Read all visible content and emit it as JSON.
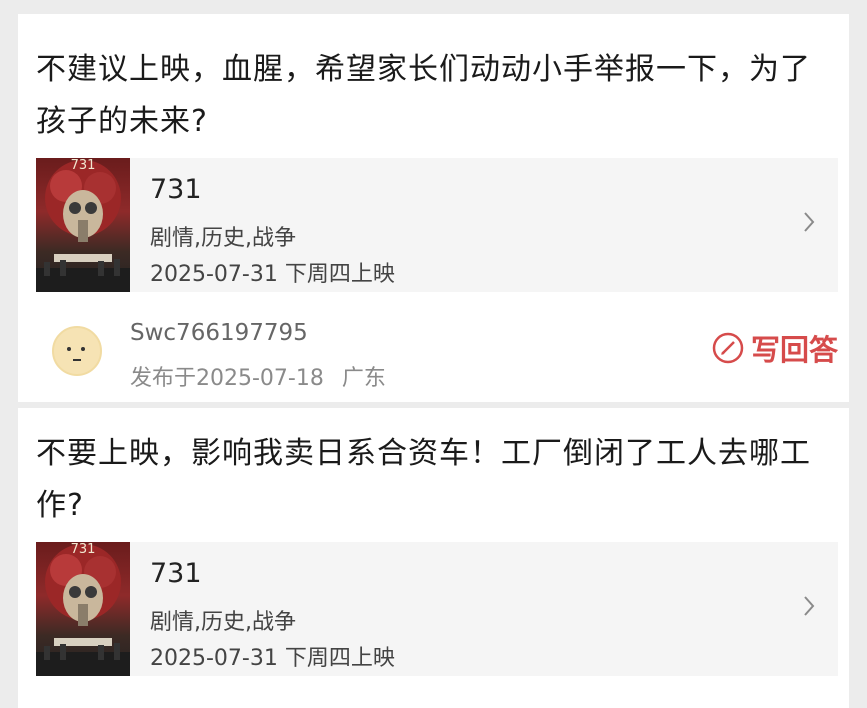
{
  "posts": [
    {
      "question": "不建议上映，血腥，希望家长们动动小手举报一下，为了孩子的未来?",
      "movie": {
        "poster_label": "731",
        "title": "731",
        "genre": "剧情,历史,战争",
        "release": "2025-07-31 下周四上映"
      },
      "user": {
        "name": "Swc766197795",
        "posted": "发布于2025-07-18",
        "location": "广东"
      },
      "answer_label": "写回答"
    },
    {
      "question": "不要上映，影响我卖日系合资车！工厂倒闭了工人去哪工作?",
      "movie": {
        "poster_label": "731",
        "title": "731",
        "genre": "剧情,历史,战争",
        "release": "2025-07-31 下周四上映"
      }
    }
  ],
  "icons": {
    "chevron": "chevron-right-icon",
    "pen": "pen-circle-icon",
    "avatar": "emoji-avatar"
  },
  "colors": {
    "accent": "#d64b4b",
    "card": "#ffffff",
    "background": "#ececec",
    "movie_bg": "#f5f5f5"
  }
}
